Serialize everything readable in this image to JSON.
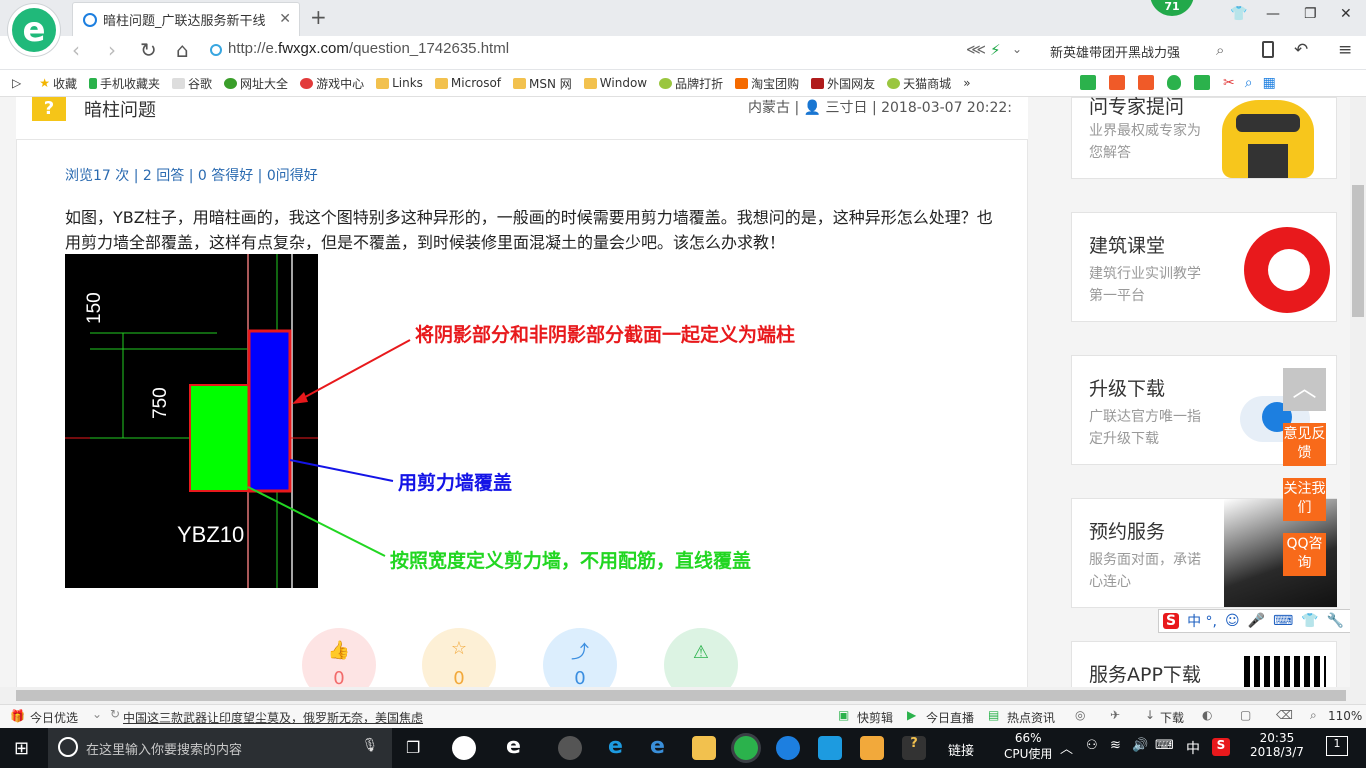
{
  "browser": {
    "tab_title": "暗柱问题_广联达服务新干线",
    "url_prefix": "http://e.",
    "url_domain": "fwxgx.com",
    "url_path": "/question_1742635.html",
    "search_hint": "新英雄带团开黑战力强",
    "notification_count": "71",
    "favorites": [
      "收藏",
      "手机收藏夹",
      "谷歌",
      "网址大全",
      "游戏中心",
      "Links",
      "Microsof",
      "MSN 网",
      "Window",
      "品牌打折",
      "淘宝团购",
      "外国网友",
      "天猫商城"
    ]
  },
  "question": {
    "icon": "?",
    "title": "暗柱问题",
    "meta": "内蒙古 | 👤 三寸日 | 2018-03-07 20:22:",
    "stats": "浏览17 次 | 2 回答 | 0 答得好 | 0问得好",
    "body": "如图，YBZ柱子，用暗柱画的，我这个图特别多这种异形的，一般画的时候需要用剪力墙覆盖。我想问的是，这种异形怎么处理？也用剪力墙全部覆盖，这样有点复杂，但是不覆盖，到时候装修里面混凝土的量会少吧。该怎么办求教！"
  },
  "figure": {
    "dim_150": "150",
    "dim_750": "750",
    "label": "YBZ10",
    "annotation_red": "将阴影部分和非阴影部分截面一起定义为端柱",
    "annotation_blue": "用剪力墙覆盖",
    "annotation_green": "按照宽度定义剪力墙，不用配筋，直线覆盖"
  },
  "actions": [
    {
      "name": "like",
      "count": "0"
    },
    {
      "name": "favorite",
      "count": "0"
    },
    {
      "name": "share",
      "count": "0"
    },
    {
      "name": "report",
      "count": ""
    }
  ],
  "sidebar": {
    "cards": [
      {
        "title": "问专家提问",
        "desc": "业界最权威专家为您解答"
      },
      {
        "title": "建筑课堂",
        "desc": "建筑行业实训教学第一平台"
      },
      {
        "title": "升级下载",
        "desc": "广联达官方唯一指定升级下载"
      },
      {
        "title": "预约服务",
        "desc": "服务面对面，承诺心连心"
      },
      {
        "title": "服务APP下载",
        "desc": ""
      }
    ],
    "float_buttons": [
      "意见反馈",
      "关注我们",
      "QQ咨询"
    ]
  },
  "ime_toolbar": "中 °,",
  "statusbar": {
    "daily": "今日优选",
    "news": "中国这三款武器让印度望尘莫及，俄罗斯无奈，美国焦虑",
    "quick_cut": "快剪辑",
    "live": "今日直播",
    "hot_news": "热点资讯",
    "download": "下载",
    "zoom": "110%"
  },
  "taskbar": {
    "search_placeholder": "在这里输入你要搜索的内容",
    "link_label": "链接",
    "cpu_percent": "66%",
    "cpu_label": "CPU使用",
    "ime": "中",
    "time": "20:35",
    "date": "2018/3/7",
    "notify_count": "1"
  },
  "colors": {
    "accent_green": "#20b97a",
    "red": "#e8191c",
    "blue": "#1414e6",
    "green": "#22d622",
    "orange": "#f86a1a"
  }
}
